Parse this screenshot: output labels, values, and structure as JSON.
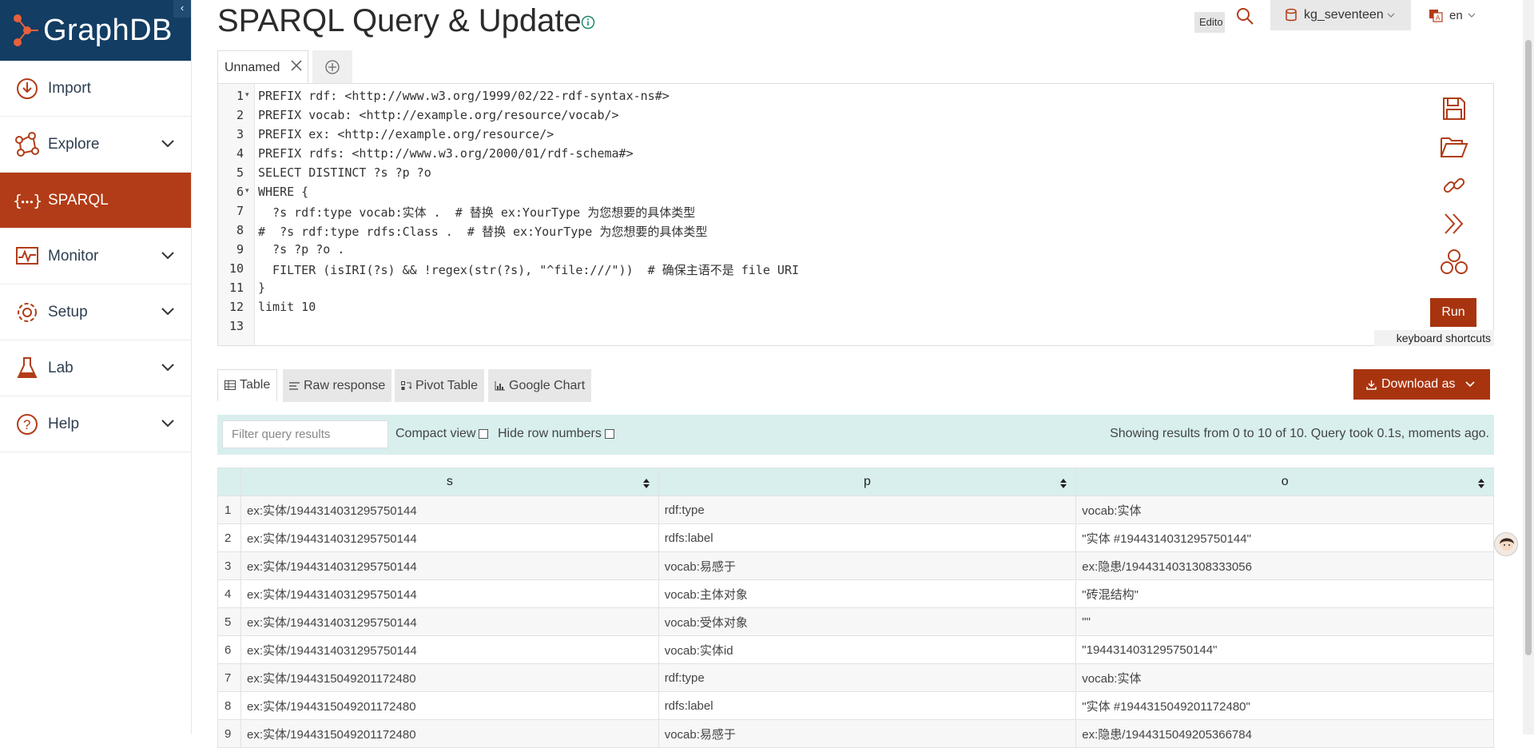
{
  "brand": {
    "name": "GraphDB",
    "colors": {
      "navy": "#133d63",
      "accent": "#b23c17",
      "teal_bg": "#d8efee"
    }
  },
  "sidebar": {
    "items": [
      {
        "label": "Import",
        "icon": "import-icon",
        "has_chevron": false,
        "active": false
      },
      {
        "label": "Explore",
        "icon": "explore-icon",
        "has_chevron": true,
        "active": false
      },
      {
        "label": "SPARQL",
        "icon": "sparql-icon",
        "has_chevron": false,
        "active": true
      },
      {
        "label": "Monitor",
        "icon": "monitor-icon",
        "has_chevron": true,
        "active": false
      },
      {
        "label": "Setup",
        "icon": "gear-icon",
        "has_chevron": true,
        "active": false
      },
      {
        "label": "Lab",
        "icon": "flask-icon",
        "has_chevron": true,
        "active": false
      },
      {
        "label": "Help",
        "icon": "help-icon",
        "has_chevron": true,
        "active": false
      }
    ]
  },
  "header": {
    "title": "SPARQL Query & Update",
    "editor_label": "Edito",
    "repository": "kg_seventeen",
    "language": "en"
  },
  "query_tabs": [
    {
      "label": "Unnamed"
    }
  ],
  "editor": {
    "line_numbers": [
      "1",
      "2",
      "3",
      "4",
      "5",
      "6",
      "7",
      "8",
      "9",
      "10",
      "11",
      "12",
      "13"
    ],
    "lines": [
      "PREFIX rdf: <http://www.w3.org/1999/02/22-rdf-syntax-ns#>",
      "PREFIX vocab: <http://example.org/resource/vocab/>",
      "PREFIX ex: <http://example.org/resource/>",
      "PREFIX rdfs: <http://www.w3.org/2000/01/rdf-schema#>",
      "SELECT DISTINCT ?s ?p ?o",
      "WHERE {",
      "  ?s rdf:type vocab:实体 .  # 替换 ex:YourType 为您想要的具体类型",
      "#  ?s rdf:type rdfs:Class .  # 替换 ex:YourType 为您想要的具体类型",
      "  ?s ?p ?o .",
      "  FILTER (isIRI(?s) && !regex(str(?s), \"^file:///\"))  # 确保主语不是 file URI",
      "}",
      "limit 10",
      ""
    ],
    "run_label": "Run",
    "keyboard_shortcuts_label": "keyboard shortcuts"
  },
  "result_tabs": [
    {
      "label": "Table",
      "icon": "table-icon",
      "active": true
    },
    {
      "label": "Raw response",
      "icon": "lines-icon",
      "active": false
    },
    {
      "label": "Pivot Table",
      "icon": "pivot-icon",
      "active": false
    },
    {
      "label": "Google Chart",
      "icon": "chart-icon",
      "active": false
    }
  ],
  "download_label": "Download as",
  "filter": {
    "placeholder": "Filter query results",
    "compact_view_label": "Compact view",
    "hide_row_numbers_label": "Hide row numbers",
    "results_info": "Showing results from 0 to 10 of 10. Query took 0.1s, moments ago."
  },
  "results_table": {
    "columns": [
      "s",
      "p",
      "o"
    ],
    "rows": [
      {
        "n": "1",
        "s": "ex:实体/1944314031295750144",
        "p": "rdf:type",
        "o": "vocab:实体"
      },
      {
        "n": "2",
        "s": "ex:实体/1944314031295750144",
        "p": "rdfs:label",
        "o": "\"实体 #1944314031295750144\""
      },
      {
        "n": "3",
        "s": "ex:实体/1944314031295750144",
        "p": "vocab:易感于",
        "o": "ex:隐患/1944314031308333056"
      },
      {
        "n": "4",
        "s": "ex:实体/1944314031295750144",
        "p": "vocab:主体对象",
        "o": "\"砖混结构\""
      },
      {
        "n": "5",
        "s": "ex:实体/1944314031295750144",
        "p": "vocab:受体对象",
        "o": "\"\""
      },
      {
        "n": "6",
        "s": "ex:实体/1944314031295750144",
        "p": "vocab:实体id",
        "o": "\"1944314031295750144\""
      },
      {
        "n": "7",
        "s": "ex:实体/1944315049201172480",
        "p": "rdf:type",
        "o": "vocab:实体"
      },
      {
        "n": "8",
        "s": "ex:实体/1944315049201172480",
        "p": "rdfs:label",
        "o": "\"实体 #1944315049201172480\""
      },
      {
        "n": "9",
        "s": "ex:实体/1944315049201172480",
        "p": "vocab:易感于",
        "o": "ex:隐患/1944315049205366784"
      }
    ]
  }
}
